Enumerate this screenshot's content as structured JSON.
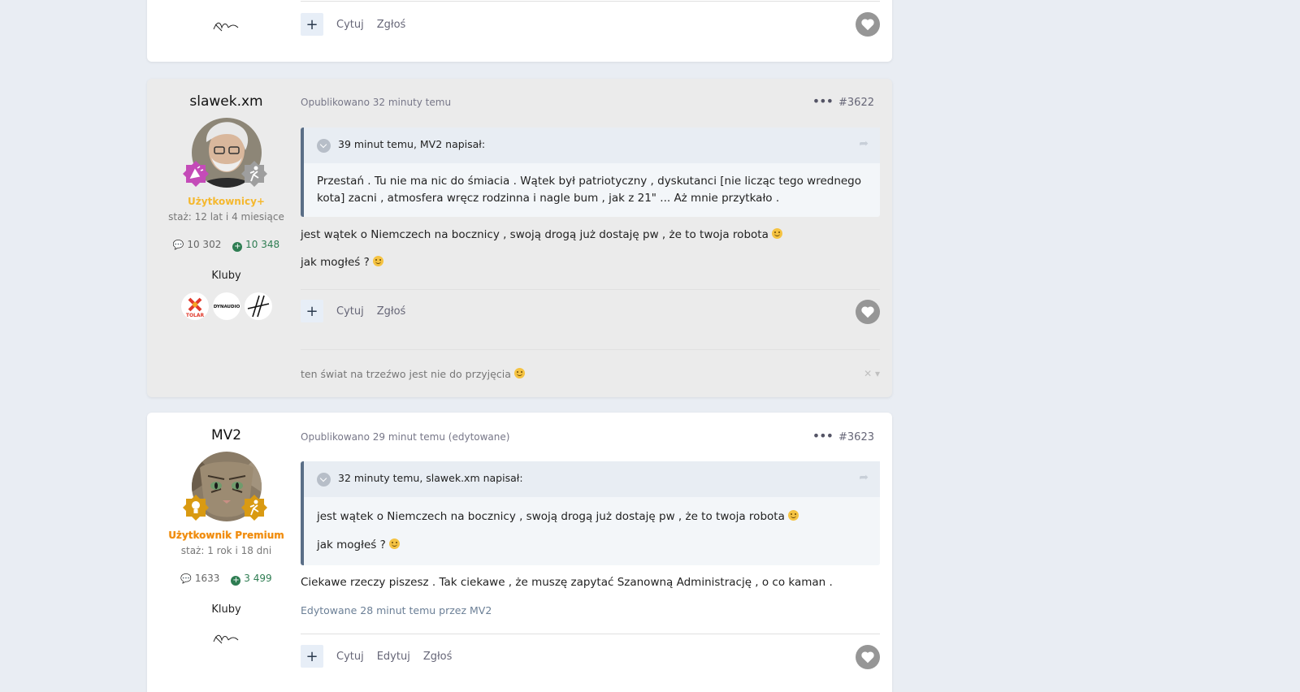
{
  "post_prev": {
    "actions": {
      "plus": "+",
      "quote": "Cytuj",
      "report": "Zgłoś"
    }
  },
  "post1": {
    "author": {
      "name": "slawek.xm",
      "group": "Użytkownicy+",
      "group_color": "#f5b82e",
      "tenure": "staż: 12 lat i 4 miesiące",
      "posts": "10 302",
      "reputation": "10 348",
      "clubs_label": "Kluby",
      "clubs": [
        "club-tolar-logo",
        "club-dynaudio-logo",
        "club-lines-logo"
      ]
    },
    "meta": "Opublikowano 32 minuty temu",
    "number": "#3622",
    "quote": {
      "header": "39 minut temu, MV2 napisał:",
      "body": "Przestań . Tu nie ma nic do śmiacia . Wątek był patriotyczny , dyskutanci [nie licząc tego wrednego kota] zacni , atmosfera wręcz rodzinna i nagle bum , jak z 21\" ... Aż mnie przytkało ."
    },
    "paragraphs": [
      "jest wątek o Niemczech na bocznicy , swoją drogą już dostaję pw , że to twoja robota",
      "jak mogłeś ?"
    ],
    "actions": {
      "plus": "+",
      "quote": "Cytuj",
      "report": "Zgłoś"
    },
    "signature": "ten świat na trzeźwo jest nie do przyjęcia",
    "signature_ctl": "✕ ▾"
  },
  "post2": {
    "author": {
      "name": "MV2",
      "group": "Użytkownik Premium",
      "group_color": "#f08a0c",
      "tenure": "staż: 1 rok i 18 dni",
      "posts": "1633",
      "reputation": "3 499",
      "clubs_label": "Kluby"
    },
    "meta": "Opublikowano 29 minut temu (edytowane)",
    "number": "#3623",
    "quote": {
      "header": "32 minuty temu, slawek.xm napisał:",
      "paragraphs": [
        "jest wątek o Niemczech na bocznicy , swoją drogą już dostaję pw , że to twoja robota",
        "jak mogłeś ?"
      ]
    },
    "paragraphs": [
      "Ciekawe rzeczy piszesz . Tak ciekawe , że muszę zapytać Szanowną Administrację , o co kaman ."
    ],
    "edited": "Edytowane 28 minut temu przez MV2",
    "actions": {
      "plus": "+",
      "quote": "Cytuj",
      "edit": "Edytuj",
      "report": "Zgłoś"
    }
  },
  "icons": {
    "comment": "comment-icon",
    "reputation": "plus-circle-icon",
    "heart": "heart-icon",
    "share": "share-icon"
  },
  "colors": {
    "background": "#e9edf3",
    "quote_border": "#5a6e87",
    "reputation": "#2e7d52"
  }
}
